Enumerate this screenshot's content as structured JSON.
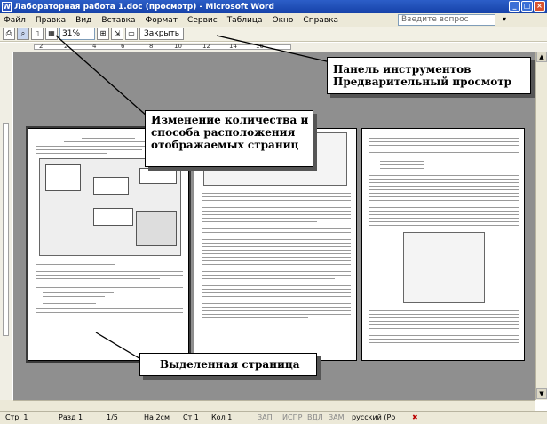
{
  "window": {
    "title": "Лабораторная работа 1.doc (просмотр) - Microsoft Word",
    "app_icon": "W"
  },
  "menu": {
    "items": [
      "Файл",
      "Правка",
      "Вид",
      "Вставка",
      "Формат",
      "Сервис",
      "Таблица",
      "Окно",
      "Справка"
    ],
    "help_placeholder": "Введите вопрос"
  },
  "toolbar": {
    "zoom_value": "31%",
    "close_label": "Закрыть"
  },
  "ruler": {
    "marks": [
      "2",
      "2",
      "4",
      "6",
      "8",
      "10",
      "12",
      "14",
      "16"
    ]
  },
  "callouts": {
    "toolbar": "Панель инструментов Предварительный просмотр",
    "pages": "Изменение количества и способа расположения отображаемых страниц",
    "selected_page": "Выделенная страница"
  },
  "status": {
    "page": "Стр. 1",
    "section": "Разд 1",
    "pages": "1/5",
    "at": "На 2см",
    "line": "Ст 1",
    "col": "Кол 1",
    "rec": "ЗАП",
    "trk": "ИСПР",
    "ext": "ВДЛ",
    "ovr": "ЗАМ",
    "lang": "русский (Ро"
  },
  "colors": {
    "titlebar": "#1f4fb8",
    "workspace": "#8f8f8f",
    "chrome": "#ece9d8"
  },
  "icons": [
    "word-icon",
    "minimize-icon",
    "maximize-icon",
    "close-icon",
    "print-icon",
    "magnifier-icon",
    "one-page-icon",
    "multiple-pages-icon",
    "view-ruler-icon",
    "full-screen-icon",
    "chevron-down-icon",
    "scroll-up-icon",
    "scroll-down-icon",
    "recording-icon"
  ]
}
